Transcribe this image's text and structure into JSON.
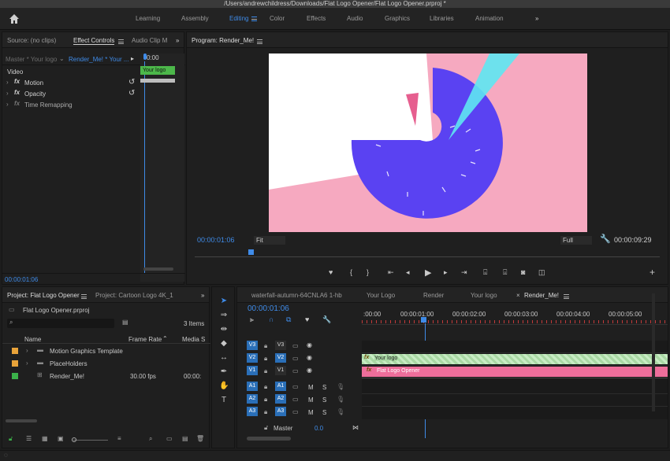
{
  "window": {
    "title": "/Users/andrewchildress/Downloads/Flat Logo Opener/Flat Logo Opener.prproj *"
  },
  "workspaces": [
    {
      "label": "Learning",
      "active": false
    },
    {
      "label": "Assembly",
      "active": false
    },
    {
      "label": "Editing",
      "active": true
    },
    {
      "label": "Color",
      "active": false
    },
    {
      "label": "Effects",
      "active": false
    },
    {
      "label": "Audio",
      "active": false
    },
    {
      "label": "Graphics",
      "active": false
    },
    {
      "label": "Libraries",
      "active": false
    },
    {
      "label": "Animation",
      "active": false
    }
  ],
  "source_panel": {
    "tabs": [
      {
        "label": "Source: (no clips)"
      },
      {
        "label": "Effect Controls"
      },
      {
        "label": "Audio Clip M"
      }
    ],
    "master_label": "Master * Your logo",
    "sequence_label": "Render_Me! * Your ...",
    "timecode_head": "0:00",
    "clip_label": "Your logo",
    "section_video": "Video",
    "effects": [
      {
        "label": "Motion"
      },
      {
        "label": "Opacity"
      },
      {
        "label": "Time Remapping"
      }
    ],
    "timecode": "00:00:01:06"
  },
  "program_panel": {
    "title": "Program: Render_Me!",
    "current_timecode": "00:00:01:06",
    "fit_label": "Fit",
    "quality_label": "Full",
    "duration": "00:00:09:29"
  },
  "project_panel": {
    "tabs": [
      {
        "label": "Project: Flat Logo Opener"
      },
      {
        "label": "Project: Cartoon Logo 4K_1"
      }
    ],
    "project_file": "Flat Logo Opener.prproj",
    "item_count": "3 Items",
    "columns": [
      "Name",
      "Frame Rate",
      "Media S"
    ],
    "rows": [
      {
        "name": "Motion Graphics Template",
        "fps": "",
        "media": "",
        "color": "#e8a33a"
      },
      {
        "name": "PlaceHolders",
        "fps": "",
        "media": "",
        "color": "#e8a33a"
      },
      {
        "name": "Render_Me!",
        "fps": "30.00 fps",
        "media": "00:00:",
        "color": "#3bb24a"
      }
    ]
  },
  "timeline_panel": {
    "tabs": [
      {
        "label": "waterfall-autumn-64CNLA6 1-hb"
      },
      {
        "label": "Your Logo"
      },
      {
        "label": "Render"
      },
      {
        "label": "Your logo"
      },
      {
        "label": "Render_Me!"
      }
    ],
    "timecode": "00:00:01:06",
    "ruler": [
      ":00:00",
      "00:00:01:00",
      "00:00:02:00",
      "00:00:03:00",
      "00:00:04:00",
      "00:00:05:00"
    ],
    "video_tracks": [
      {
        "target": "V3",
        "name": "V3"
      },
      {
        "target": "V2",
        "name": "V2"
      },
      {
        "target": "V1",
        "name": "V1"
      }
    ],
    "audio_tracks": [
      {
        "target": "A1",
        "name": "A1"
      },
      {
        "target": "A2",
        "name": "A2"
      },
      {
        "target": "A3",
        "name": "A3"
      }
    ],
    "clips": [
      {
        "label": "Your logo",
        "color": "#a9d8a4"
      },
      {
        "label": "Flat Logo Opener",
        "color": "#ee6e9b"
      }
    ],
    "master_label": "Master",
    "master_value": "0.0",
    "mute_label": "M",
    "solo_label": "S"
  },
  "colors": {
    "accent": "#3f8be8",
    "graphic_pink": "#f6a9c0",
    "graphic_purple": "#5a42f2",
    "graphic_cyan": "#5ee7f2"
  }
}
